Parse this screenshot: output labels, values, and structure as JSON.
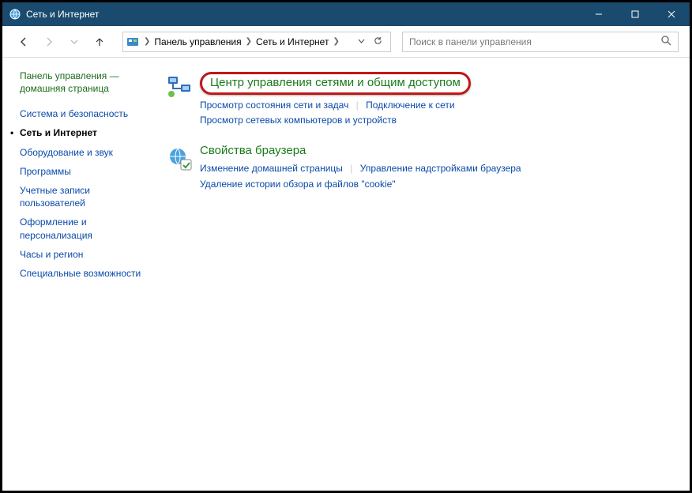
{
  "titlebar": {
    "title": "Сеть и Интернет"
  },
  "breadcrumbs": {
    "root": "Панель управления",
    "current": "Сеть и Интернет"
  },
  "search": {
    "placeholder": "Поиск в панели управления"
  },
  "sidebar": {
    "home": "Панель управления — домашняя страница",
    "items": [
      {
        "label": "Система и безопасность"
      },
      {
        "label": "Сеть и Интернет",
        "active": true
      },
      {
        "label": "Оборудование и звук"
      },
      {
        "label": "Программы"
      },
      {
        "label": "Учетные записи пользователей"
      },
      {
        "label": "Оформление и персонализация"
      },
      {
        "label": "Часы и регион"
      },
      {
        "label": "Специальные возможности"
      }
    ]
  },
  "content": {
    "network_center": {
      "title": "Центр управления сетями и общим доступом",
      "links": {
        "a": "Просмотр состояния сети и задач",
        "b": "Подключение к сети",
        "c": "Просмотр сетевых компьютеров и устройств"
      }
    },
    "browser_props": {
      "title": "Свойства браузера",
      "links": {
        "a": "Изменение домашней страницы",
        "b": "Управление надстройками браузера",
        "c": "Удаление истории обзора и файлов \"cookie\""
      }
    }
  }
}
